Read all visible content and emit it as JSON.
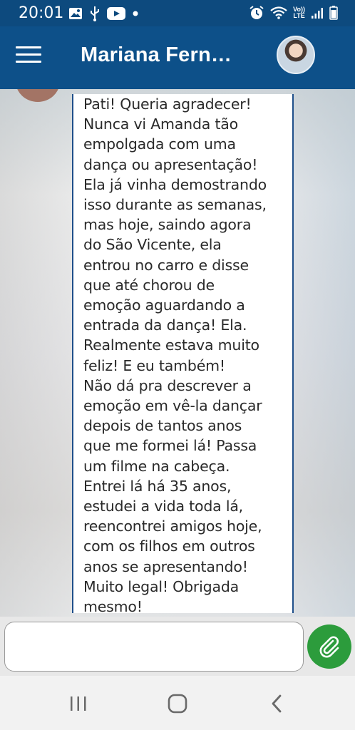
{
  "status_bar": {
    "time": "20:01",
    "lte_top": "Vo))",
    "lte_bottom": "LTE",
    "icons": [
      "image-icon",
      "usb-icon",
      "youtube-icon",
      "dot-icon",
      "alarm-icon",
      "wifi-icon",
      "signal-icon",
      "battery-icon"
    ]
  },
  "header": {
    "title": "Mariana Fern…",
    "menu_icon": "hamburger-menu-icon",
    "avatar": "contact-avatar"
  },
  "message": {
    "text": "Pati! Queria agradecer!\nNunca vi Amanda tão\nempolgada com uma\ndança ou apresentação!\nEla já vinha demostrando\nisso durante as semanas,\nmas hoje, saindo agora\ndo São Vicente, ela\nentrou no carro e disse\nque até chorou de\nemoção aguardando a\nentrada da dança! Ela.\nRealmente estava muito\nfeliz! E eu também!\nNão dá pra descrever a\nemoção em vê-la dançar\ndepois de tantos anos\nque me formei lá! Passa\num filme na cabeça.\nEntrei lá há 35 anos,\nestudei a vida toda lá,\nreencontrei amigos hoje,\ncom os filhos em outros\nanos se apresentando!\nMuito legal! Obrigada\nmesmo!"
  },
  "composer": {
    "input_value": "",
    "attach_icon": "paperclip-icon",
    "accent_color": "#2c9c3c"
  },
  "nav_bar": {
    "icons": [
      "recent-apps-icon",
      "home-icon",
      "back-icon"
    ]
  },
  "colors": {
    "header_bg": "#0d5089",
    "status_bg": "#0d4a7e",
    "bubble_border": "#1f4f8a"
  }
}
